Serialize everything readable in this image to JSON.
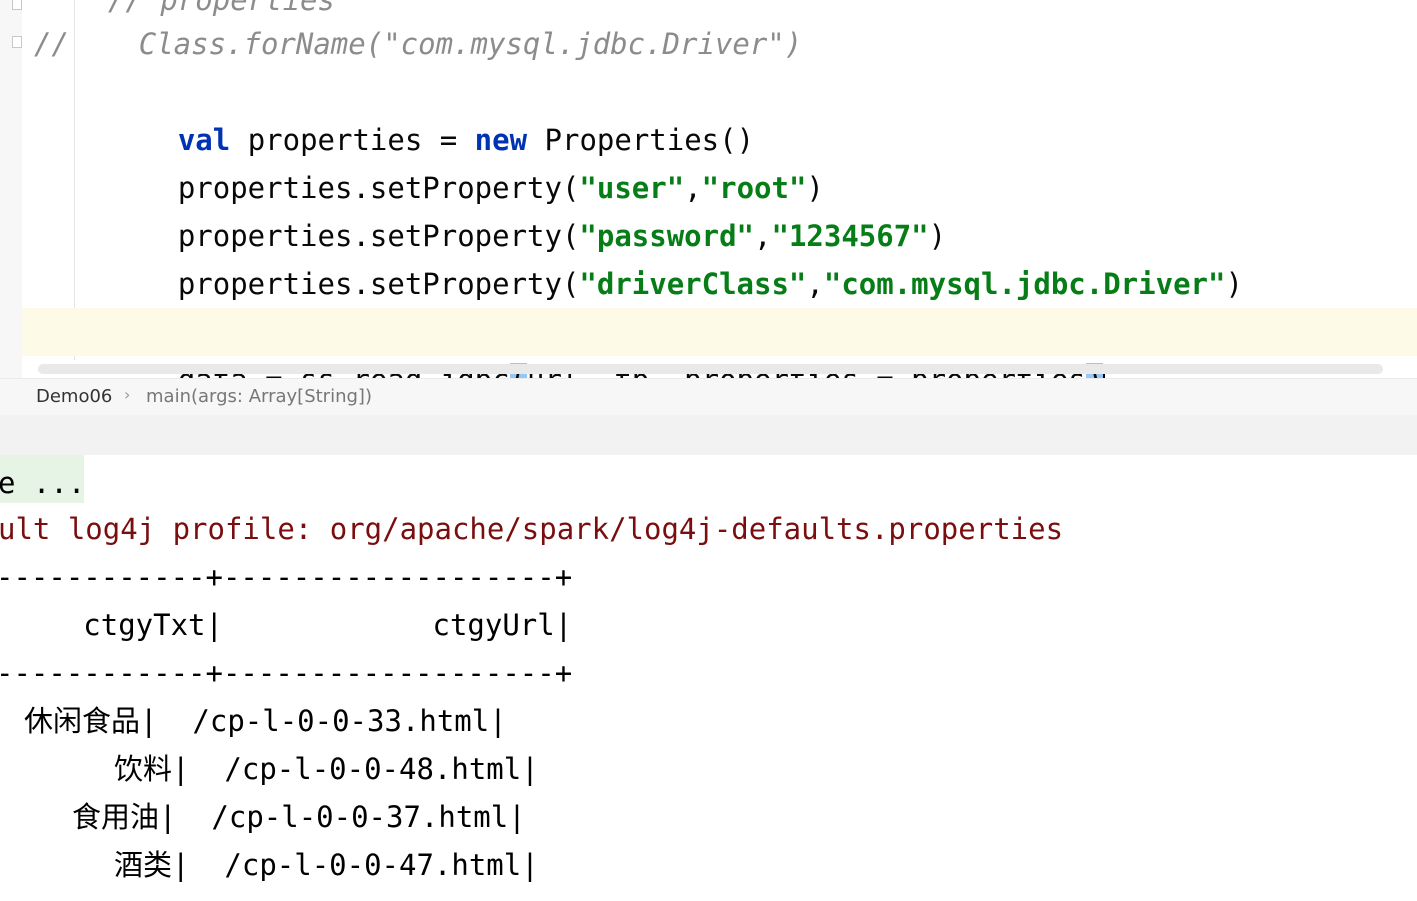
{
  "editor": {
    "lines": [
      {
        "text": "// properties"
      },
      {
        "text": "//    Class.forName(\"com.mysql.jdbc.Driver\")"
      },
      {
        "parts": [
          {
            "t": "val",
            "c": "kw"
          },
          {
            "t": " properties = "
          },
          {
            "t": "new",
            "c": "kw"
          },
          {
            "t": " Properties()"
          }
        ]
      },
      {
        "parts": [
          {
            "t": "properties.setProperty("
          },
          {
            "t": "\"user\"",
            "c": "str"
          },
          {
            "t": ","
          },
          {
            "t": "\"root\"",
            "c": "str"
          },
          {
            "t": ")"
          }
        ]
      },
      {
        "parts": [
          {
            "t": "properties.setProperty("
          },
          {
            "t": "\"password\"",
            "c": "str"
          },
          {
            "t": ","
          },
          {
            "t": "\"1234567\"",
            "c": "str"
          },
          {
            "t": ")"
          }
        ]
      },
      {
        "parts": [
          {
            "t": "properties.setProperty("
          },
          {
            "t": "\"driverClass\"",
            "c": "str"
          },
          {
            "t": ","
          },
          {
            "t": "\"com.mysql.jdbc.Driver\"",
            "c": "str"
          },
          {
            "t": ")"
          }
        ]
      },
      {
        "parts": [
          {
            "t": "data = ss.read.jdbc"
          },
          {
            "t": "(",
            "c": "brace"
          },
          {
            "t": "url, tb, properties = properties"
          },
          {
            "t": ")",
            "c": "brace"
          }
        ]
      }
    ]
  },
  "breadcrumb": {
    "items": [
      "Demo06",
      "main(args: Array[String])"
    ],
    "separator": "›"
  },
  "console": {
    "lines": [
      "e ...",
      "ult log4j profile: org/apache/spark/log4j-defaults.properties",
      "------------+-------------------+",
      "     ctgyTxt|            ctgyUrl|",
      "------------+-------------------+"
    ],
    "rows": [
      {
        "txt": "休闲食品",
        "url": "/cp-l-0-0-33.html"
      },
      {
        "txt": "饮料",
        "url": "/cp-l-0-0-48.html"
      },
      {
        "txt": "食用油",
        "url": "/cp-l-0-0-37.html"
      },
      {
        "txt": "酒类",
        "url": "/cp-l-0-0-47.html"
      }
    ]
  }
}
